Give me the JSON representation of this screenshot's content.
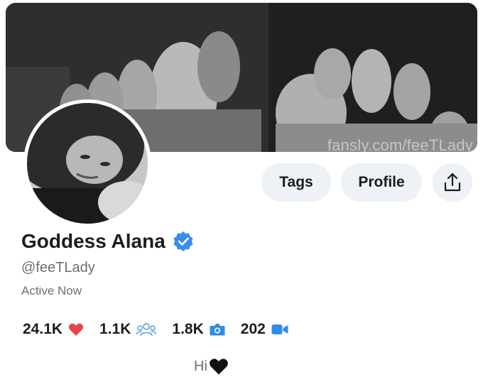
{
  "banner": {
    "watermark": "fansly.com/feeTLady"
  },
  "buttons": {
    "tags_label": "Tags",
    "profile_label": "Profile",
    "share_icon": "share-icon"
  },
  "profile": {
    "name": "Goddess Alana",
    "handle": "@feeTLady",
    "status": "Active Now",
    "bio": "Hi"
  },
  "stats": [
    {
      "value": "24.1K",
      "icon": "heart-icon",
      "color": "#e0474c"
    },
    {
      "value": "1.1K",
      "icon": "followers-icon",
      "color": "#5a9bd8"
    },
    {
      "value": "1.8K",
      "icon": "camera-icon",
      "color": "#2f8ce8"
    },
    {
      "value": "202",
      "icon": "video-icon",
      "color": "#2f8ce8"
    }
  ],
  "colors": {
    "accent": "#2f8ce8",
    "verified": "#3a8cef",
    "pill_bg": "#eef1f6"
  }
}
